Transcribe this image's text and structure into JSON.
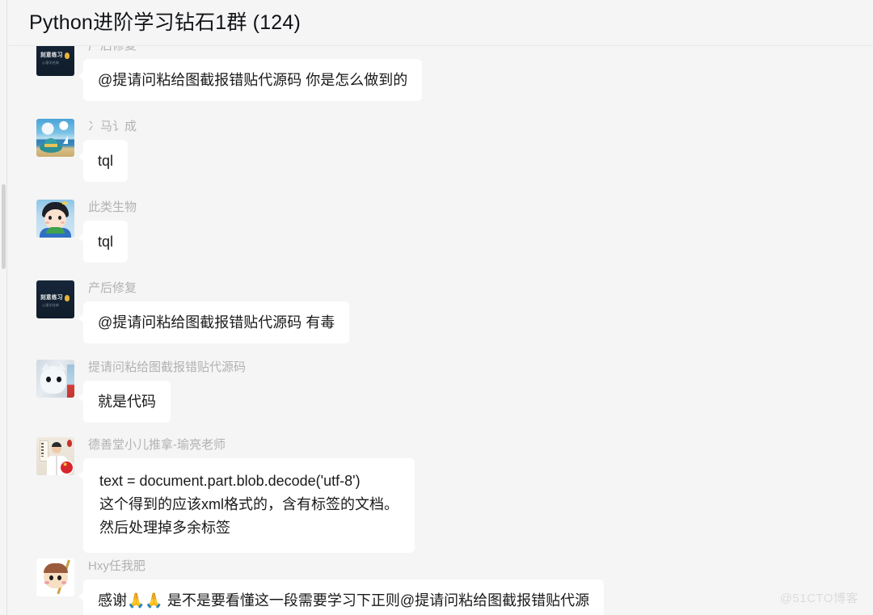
{
  "header": {
    "title": "Python进阶学习钻石1群 (124)"
  },
  "messages": [
    {
      "sender": "产后修复",
      "avatar": "book-avatar",
      "text": "@提请问粘给图截报错贴代源码 你是怎么做到的"
    },
    {
      "sender": "冫马讠成",
      "avatar": "beach-avatar",
      "text": "tql"
    },
    {
      "sender": "此类生物",
      "avatar": "boy-avatar",
      "text": "tql"
    },
    {
      "sender": "产后修复",
      "avatar": "book-avatar",
      "text": "@提请问粘给图截报错贴代源码 有毒"
    },
    {
      "sender": "提请问粘给图截报错贴代源码",
      "avatar": "cat-avatar",
      "text": "就是代码"
    },
    {
      "sender": "德善堂小儿推拿-瑜亮老师",
      "avatar": "doctor-avatar",
      "text": "text = document.part.blob.decode('utf-8')\n这个得到的应该xml格式的，含有标签的文档。\n然后处理掉多余标签"
    },
    {
      "sender": "Hxy任我肥",
      "avatar": "monkey-avatar",
      "text": "感谢🙏🙏 是不是要看懂这一段需要学习下正则@提请问粘给图截报错贴代源"
    }
  ],
  "watermark": {
    "text": "@51CTO博客"
  },
  "colors": {
    "background": "#f5f5f5",
    "bubble": "#ffffff",
    "sender_name": "#b2b2b2",
    "title": "#111318",
    "watermark": "#dcdcdc"
  }
}
